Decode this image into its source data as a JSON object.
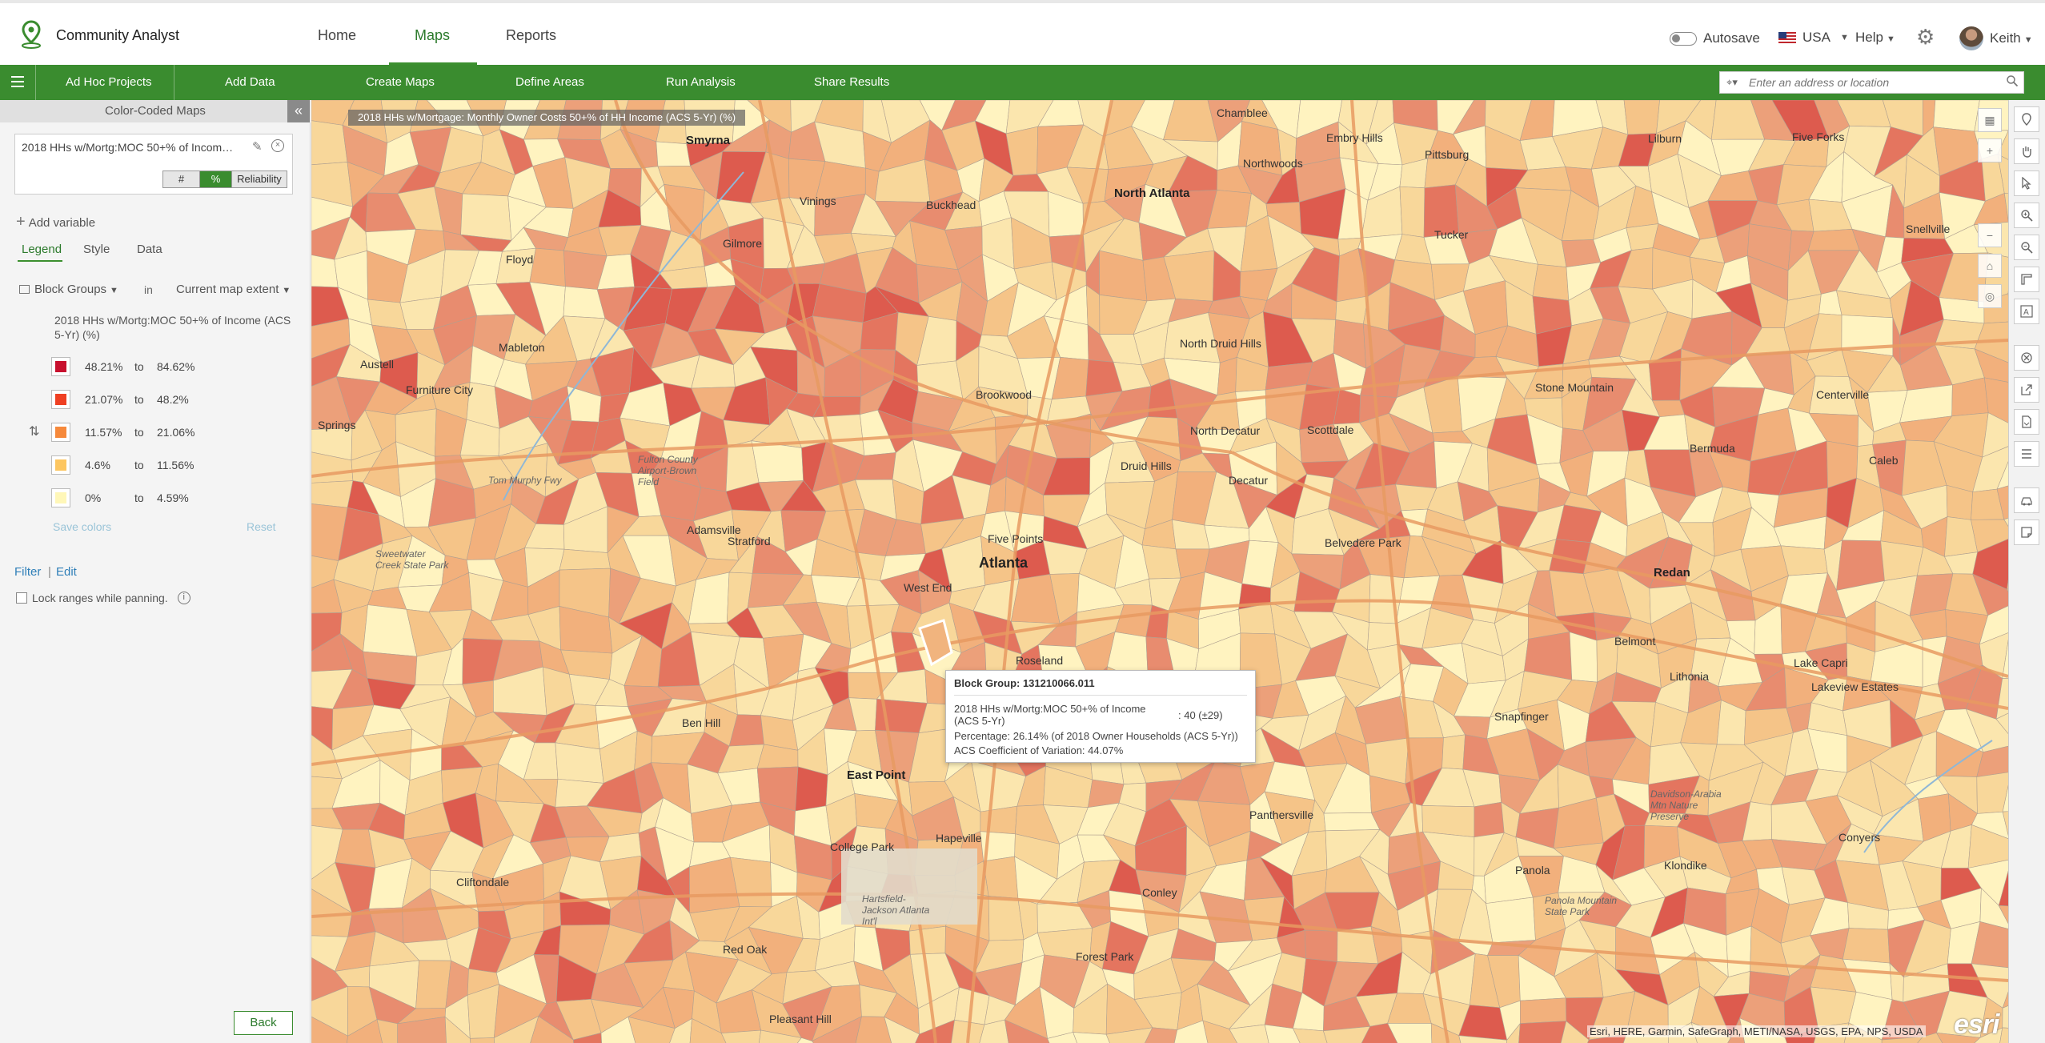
{
  "header": {
    "app_title": "Community Analyst",
    "nav": [
      {
        "label": "Home",
        "active": false
      },
      {
        "label": "Maps",
        "active": true
      },
      {
        "label": "Reports",
        "active": false
      }
    ],
    "autosave_label": "Autosave",
    "country_label": "USA",
    "help_label": "Help",
    "user_name": "Keith"
  },
  "toolbar": {
    "items": [
      "Ad Hoc Projects",
      "Add Data",
      "Create Maps",
      "Define Areas",
      "Run Analysis",
      "Share Results"
    ],
    "search_placeholder": "Enter an address or location"
  },
  "panel": {
    "title": "Color-Coded Maps",
    "variable_name": "2018 HHs w/Mortg:MOC 50+% of Income (ACS 5-Yr) (%)",
    "display_options": [
      "#",
      "%",
      "Reliability"
    ],
    "selected_display": "%",
    "add_variable_label": "Add variable",
    "tabs": [
      "Legend",
      "Style",
      "Data"
    ],
    "active_tab": "Legend",
    "geography_label": "Block Groups",
    "in_label": "in",
    "extent_label": "Current map extent",
    "legend_title": "2018 HHs w/Mortg:MOC 50+% of Income (ACS 5-Yr) (%)",
    "legend": [
      {
        "min": "48.21%",
        "to": "to",
        "max": "84.62%",
        "color": "#c8102e"
      },
      {
        "min": "21.07%",
        "to": "to",
        "max": "48.2%",
        "color": "#ef4023"
      },
      {
        "min": "11.57%",
        "to": "to",
        "max": "21.06%",
        "color": "#f6893b"
      },
      {
        "min": "4.6%",
        "to": "to",
        "max": "11.56%",
        "color": "#fdc660"
      },
      {
        "min": "0%",
        "to": "to",
        "max": "4.59%",
        "color": "#fff7b8"
      }
    ],
    "save_colors_label": "Save colors",
    "reset_label": "Reset",
    "filter_label": "Filter",
    "edit_label": "Edit",
    "lock_label": "Lock ranges while panning.",
    "back_label": "Back"
  },
  "map": {
    "title": "2018 HHs w/Mortgage: Monthly Owner Costs 50+% of HH Income (ACS 5-Yr) (%)",
    "places": [
      {
        "name": "Smyrna",
        "cls": "big"
      },
      {
        "name": "Vinings",
        "cls": ""
      },
      {
        "name": "Buckhead",
        "cls": ""
      },
      {
        "name": "Chamblee",
        "cls": ""
      },
      {
        "name": "Embry Hills",
        "cls": ""
      },
      {
        "name": "Pittsburg",
        "cls": ""
      },
      {
        "name": "Lilburn",
        "cls": ""
      },
      {
        "name": "Five Forks",
        "cls": ""
      },
      {
        "name": "Northwoods",
        "cls": ""
      },
      {
        "name": "North Atlanta",
        "cls": "big"
      },
      {
        "name": "Tucker",
        "cls": ""
      },
      {
        "name": "Gilmore",
        "cls": ""
      },
      {
        "name": "Floyd",
        "cls": ""
      },
      {
        "name": "Snellville",
        "cls": ""
      },
      {
        "name": "Mableton",
        "cls": ""
      },
      {
        "name": "North Druid Hills",
        "cls": ""
      },
      {
        "name": "Austell",
        "cls": ""
      },
      {
        "name": "Furniture City",
        "cls": ""
      },
      {
        "name": "Brookwood",
        "cls": ""
      },
      {
        "name": "Stone Mountain",
        "cls": ""
      },
      {
        "name": "Centerville",
        "cls": ""
      },
      {
        "name": "Springs",
        "cls": ""
      },
      {
        "name": "North Decatur",
        "cls": ""
      },
      {
        "name": "Scottdale",
        "cls": ""
      },
      {
        "name": "Bermuda",
        "cls": ""
      },
      {
        "name": "Caleb",
        "cls": ""
      },
      {
        "name": "Fulton County Airport-Brown Field",
        "cls": "small"
      },
      {
        "name": "Druid Hills",
        "cls": ""
      },
      {
        "name": "Decatur",
        "cls": ""
      },
      {
        "name": "Tom Murphy Fwy",
        "cls": "small"
      },
      {
        "name": "Adamsville",
        "cls": ""
      },
      {
        "name": "Stratford",
        "cls": ""
      },
      {
        "name": "Five Points",
        "cls": ""
      },
      {
        "name": "Belvedere Park",
        "cls": ""
      },
      {
        "name": "Sweetwater Creek State Park",
        "cls": "small"
      },
      {
        "name": "Atlanta",
        "cls": "city"
      },
      {
        "name": "Redan",
        "cls": "big"
      },
      {
        "name": "West End",
        "cls": ""
      },
      {
        "name": "Belmont",
        "cls": ""
      },
      {
        "name": "Roseland",
        "cls": ""
      },
      {
        "name": "Lithonia",
        "cls": ""
      },
      {
        "name": "Lake Capri",
        "cls": ""
      },
      {
        "name": "Lakeview Estates",
        "cls": ""
      },
      {
        "name": "Ben Hill",
        "cls": ""
      },
      {
        "name": "Snapfinger",
        "cls": ""
      },
      {
        "name": "East Point",
        "cls": "big"
      },
      {
        "name": "Panthersville",
        "cls": ""
      },
      {
        "name": "Davidson-Arabia Mtn Nature Preserve",
        "cls": "small"
      },
      {
        "name": "Conyers",
        "cls": ""
      },
      {
        "name": "Hapeville",
        "cls": ""
      },
      {
        "name": "College Park",
        "cls": ""
      },
      {
        "name": "Klondike",
        "cls": ""
      },
      {
        "name": "Cliftondale",
        "cls": ""
      },
      {
        "name": "Panola",
        "cls": ""
      },
      {
        "name": "Conley",
        "cls": ""
      },
      {
        "name": "Hartsfield-Jackson Atlanta Int'l",
        "cls": "small"
      },
      {
        "name": "Panola Mountain State Park",
        "cls": "small"
      },
      {
        "name": "Red Oak",
        "cls": ""
      },
      {
        "name": "Forest Park",
        "cls": ""
      },
      {
        "name": "Pleasant Hill",
        "cls": ""
      }
    ],
    "popup": {
      "title": "Block Group: 131210066.011",
      "variable": "2018 HHs w/Mortg:MOC 50+% of Income (ACS 5-Yr)",
      "value": ": 40 (±29)",
      "percentage": "Percentage:  26.14% (of 2018 Owner Households (ACS 5-Yr))",
      "cv": "ACS Coefficient of Variation:  44.07%"
    },
    "attribution": "Esri, HERE, Garmin, SafeGraph, METI/NASA, USGS, EPA, NPS, USDA",
    "esri_logo": "esri"
  }
}
